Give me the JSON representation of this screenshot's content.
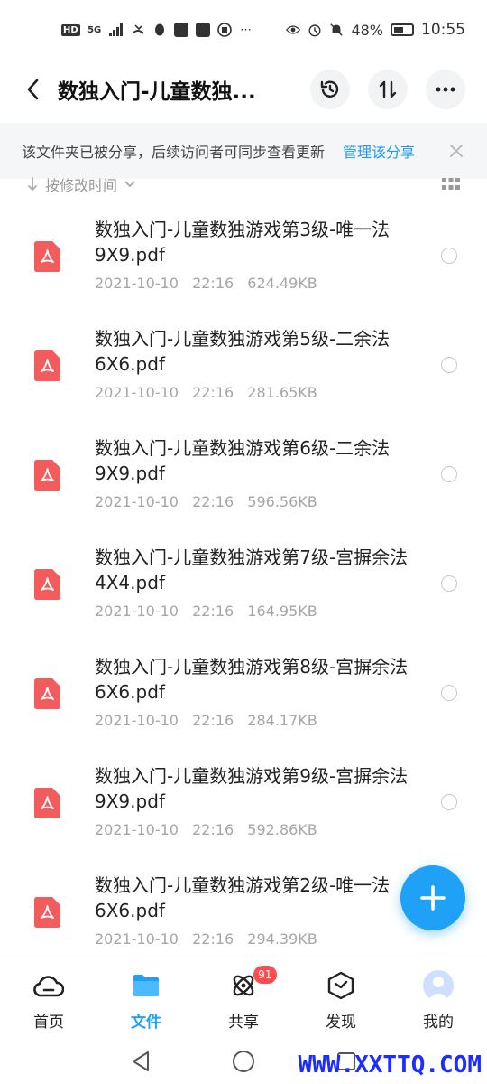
{
  "status_bar": {
    "hd": "HD",
    "network": "5G",
    "battery": "48%",
    "time": "10:55"
  },
  "header": {
    "title": "数独入门-儿童数独...",
    "back_icon": "chevron-left-icon",
    "history_icon": "history-icon",
    "sort_icon": "sort-arrows-icon",
    "more_icon": "more-dots-icon"
  },
  "banner": {
    "text": "该文件夹已被分享，后续访问者可同步查看更新",
    "link": "管理该分享",
    "close_icon": "close-icon"
  },
  "sort": {
    "label": "按修改时间",
    "arrow_icon": "arrow-down-icon",
    "caret_icon": "chevron-down-icon",
    "grid_icon": "grid-view-icon"
  },
  "files": [
    {
      "name": "数独入门-儿童数独游戏第3级-唯一法9X9.pdf",
      "date": "2021-10-10",
      "time": "22:16",
      "size": "624.49KB"
    },
    {
      "name": "数独入门-儿童数独游戏第5级-二余法6X6.pdf",
      "date": "2021-10-10",
      "time": "22:16",
      "size": "281.65KB"
    },
    {
      "name": "数独入门-儿童数独游戏第6级-二余法9X9.pdf",
      "date": "2021-10-10",
      "time": "22:16",
      "size": "596.56KB"
    },
    {
      "name": "数独入门-儿童数独游戏第7级-宫摒余法4X4.pdf",
      "date": "2021-10-10",
      "time": "22:16",
      "size": "164.95KB"
    },
    {
      "name": "数独入门-儿童数独游戏第8级-宫摒余法6X6.pdf",
      "date": "2021-10-10",
      "time": "22:16",
      "size": "284.17KB"
    },
    {
      "name": "数独入门-儿童数独游戏第9级-宫摒余法9X9.pdf",
      "date": "2021-10-10",
      "time": "22:16",
      "size": "592.86KB"
    },
    {
      "name": "数独入门-儿童数独游戏第2级-唯一法6X6.pdf",
      "date": "2021-10-10",
      "time": "22:16",
      "size": "294.39KB"
    }
  ],
  "nav": {
    "items": [
      {
        "label": "首页",
        "icon": "cloud-home-icon"
      },
      {
        "label": "文件",
        "icon": "folder-icon",
        "active": true
      },
      {
        "label": "共享",
        "icon": "atom-share-icon",
        "badge": "91"
      },
      {
        "label": "发现",
        "icon": "cube-discover-icon"
      },
      {
        "label": "我的",
        "icon": "avatar-icon"
      }
    ]
  },
  "colors": {
    "accent": "#1ea1f7",
    "pdf": "#f25c5c",
    "badge": "#ff4d4f"
  },
  "watermark": "WWW.XXTTQ.COM"
}
